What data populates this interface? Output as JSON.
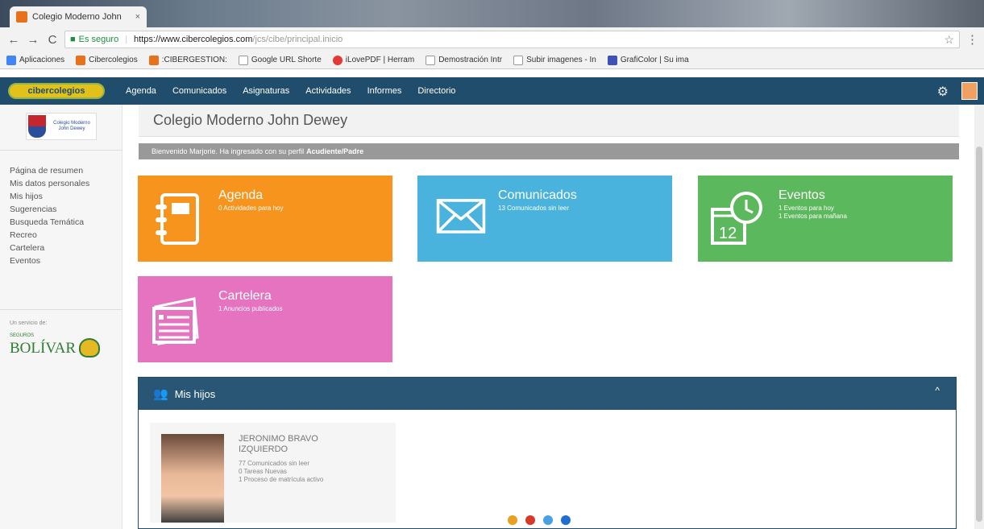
{
  "browser": {
    "tab_title": "Colegio Moderno John",
    "tab_close": "×",
    "secure_label": "Es seguro",
    "url_host": "https://www.cibercolegios.com",
    "url_path": "/jcs/cibe/principal.inicio",
    "back": "←",
    "forward": "→",
    "reload": "C",
    "star": "☆",
    "menu": "⋮",
    "bookmarks": [
      {
        "label": "Aplicaciones",
        "color": "#4285f4"
      },
      {
        "label": "Cibercolegios",
        "color": "#e8711c"
      },
      {
        "label": ":CIBERGESTION:",
        "color": "#e8711c"
      },
      {
        "label": "Google URL Shorte",
        "color": "#999999"
      },
      {
        "label": "iLovePDF | Herram",
        "color": "#e53935"
      },
      {
        "label": "Demostración Intr",
        "color": "#999999"
      },
      {
        "label": "Subir imagenes - In",
        "color": "#999999"
      },
      {
        "label": "GrafiColor | Su ima",
        "color": "#3f51b5"
      }
    ]
  },
  "appnav": {
    "logo": "cibercolegios",
    "items": [
      "Agenda",
      "Comunicados",
      "Asignaturas",
      "Actividades",
      "Informes",
      "Directorio"
    ],
    "gear": "⚙"
  },
  "sidebar": {
    "school_logo_text": "Colegio Moderno John Dewey",
    "items": [
      "Página de resumen",
      "Mis datos personales",
      "Mis hijos",
      "Sugerencias",
      "Busqueda Temática",
      "Recreo",
      "Cartelera",
      "Eventos"
    ],
    "service_label": "Un servicio de:",
    "sponsor_small": "SEGUROS",
    "sponsor_name": "BOLÍVAR"
  },
  "main": {
    "title": "Colegio Moderno John Dewey",
    "welcome_text": "Bienvenido Marjorie. Ha ingresado con su perfil",
    "welcome_profile": "Acudiente/Padre",
    "tiles": {
      "agenda": {
        "title": "Agenda",
        "lines": [
          "0 Actividades para hoy"
        ]
      },
      "comunicados": {
        "title": "Comunicados",
        "lines": [
          "13 Comunicados sin leer"
        ]
      },
      "eventos": {
        "title": "Eventos",
        "lines": [
          "1 Eventos para hoy",
          "1 Eventos para mañana"
        ],
        "calendar_number": "12"
      },
      "cartelera": {
        "title": "Cartelera",
        "lines": [
          "1 Anuncios publicados"
        ]
      }
    },
    "panel": {
      "title": "Mis hijos",
      "caret": "^",
      "child": {
        "name_line1": "JERONIMO BRAVO",
        "name_line2": "IZQUIERDO",
        "info": [
          "77 Comunicados sin leer",
          "0 Tareas Nuevas",
          "1 Proceso de matrícula activo"
        ]
      }
    }
  },
  "colors": {
    "nav": "#1f4d6b",
    "agenda": "#f7941d",
    "comunicados": "#4ab3dd",
    "eventos": "#5cb85c",
    "cartelera": "#e573c0"
  }
}
